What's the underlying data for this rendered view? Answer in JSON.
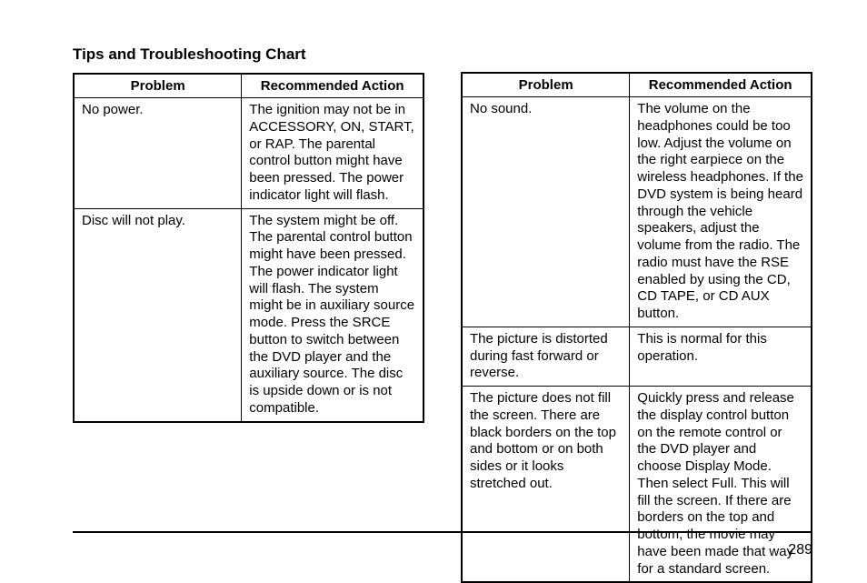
{
  "title": "Tips and Troubleshooting Chart",
  "pageNumber": "289",
  "left": {
    "headers": {
      "problem": "Problem",
      "action": "Recommended Action"
    },
    "rows": [
      {
        "problem": "No power.",
        "action": "The ignition may not be in ACCESSORY, ON, START, or RAP. The parental control button might have been pressed. The power indicator light will flash."
      },
      {
        "problem": "Disc will not play.",
        "action": "The system might be off. The parental control button might have been pressed. The power indicator light will flash. The system might be in auxiliary source mode. Press the SRCE button to switch between the DVD player and the auxiliary source. The disc is upside down or is not compatible."
      }
    ]
  },
  "right": {
    "headers": {
      "problem": "Problem",
      "action": "Recommended Action"
    },
    "rows": [
      {
        "problem": "No sound.",
        "action": "The volume on the headphones could be too low. Adjust the volume on the right earpiece on the wireless headphones. If the DVD system is being heard through the vehicle speakers, adjust the volume from the radio. The radio must have the RSE enabled by using the CD, CD TAPE, or CD AUX button."
      },
      {
        "problem": "The picture is distorted during fast forward or reverse.",
        "action": "This is normal for this operation."
      },
      {
        "problem": "The picture does not fill the screen. There are black borders on the top and bottom or on both sides or it looks stretched out.",
        "action": "Quickly press and release the display control button on the remote control or the DVD player and choose Display Mode. Then select Full. This will fill the screen. If there are borders on the top and bottom, the movie may have been made that way for a standard screen."
      }
    ]
  }
}
